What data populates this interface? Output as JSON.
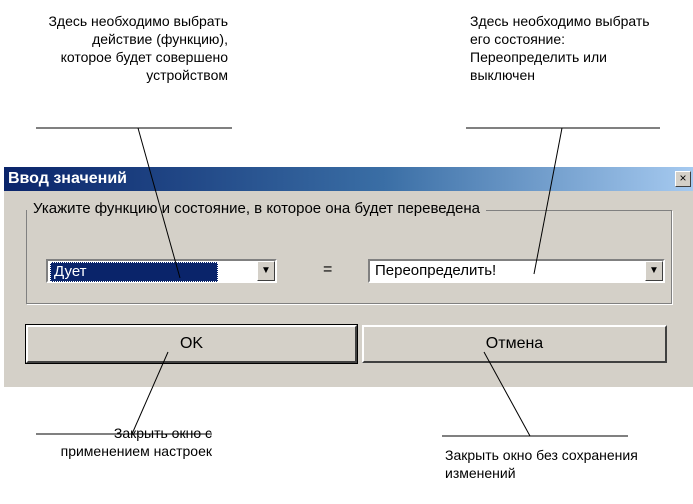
{
  "annotations": {
    "top_left": "Здесь необходимо выбрать действие (функцию), которое будет совершено устройством",
    "top_right": "Здесь необходимо выбрать его состояние: Переопределить или выключен",
    "bottom_left": "Закрыть окно с применением настроек",
    "bottom_right": "Закрыть окно без сохранения изменений"
  },
  "dialog": {
    "title": "Ввод значений",
    "close_glyph": "×",
    "group_label": "Укажите функцию и состояние, в которое она будет переведена",
    "function_value": "Дует",
    "equals": "=",
    "state_value": "Переопределить!",
    "ok_label": "OK",
    "cancel_label": "Отмена",
    "dropdown_glyph": "▼"
  },
  "colors": {
    "titlebar_start": "#0a246a",
    "titlebar_end": "#a6caf0",
    "dialog_bg": "#d4d0c8",
    "selection": "#0a246a"
  }
}
